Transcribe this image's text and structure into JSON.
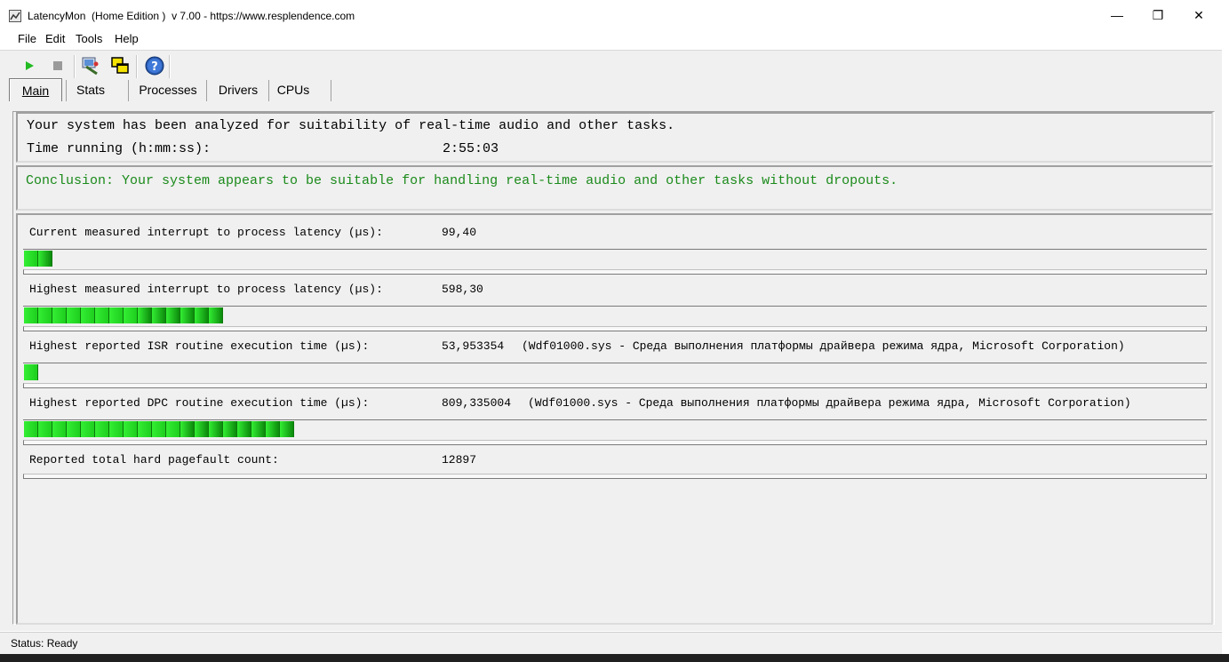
{
  "window": {
    "title": "LatencyMon  (Home Edition )  v 7.00 - https://www.resplendence.com",
    "minimize_glyph": "—",
    "maximize_glyph": "❐",
    "close_glyph": "✕"
  },
  "menu": [
    "File",
    "Edit",
    "Tools",
    "Help"
  ],
  "toolbar": [
    "play-icon",
    "stop-icon",
    "inspect-icon",
    "windows-icon",
    "help-icon"
  ],
  "tabs": [
    "Main",
    "Stats",
    "Processes",
    "Drivers",
    "CPUs"
  ],
  "analysis": {
    "line1": "Your system has been analyzed for suitability of real-time audio and other tasks.",
    "time_label": "Time running (h:mm:ss):",
    "time_value": "2:55:03"
  },
  "conclusion": "Conclusion: Your system appears to be suitable for handling real-time audio and other tasks without dropouts.",
  "metrics": [
    {
      "label": "Current measured interrupt to process latency (µs):",
      "value": "99,40",
      "detail": "",
      "level_segments": 2
    },
    {
      "label": "Highest measured interrupt to process latency (µs):",
      "value": "598,30",
      "detail": "",
      "level_segments": 14
    },
    {
      "label": "Highest reported ISR routine execution time (µs):",
      "value": "53,953354",
      "detail": "(Wdf01000.sys - Среда выполнения платформы драйвера режима ядра, Microsoft Corporation)",
      "level_segments": 1
    },
    {
      "label": "Highest reported DPC routine execution time (µs):",
      "value": "809,335004",
      "detail": "(Wdf01000.sys - Среда выполнения платформы драйвера режима ядра, Microsoft Corporation)",
      "level_segments": 19
    },
    {
      "label": "Reported total hard pagefault count:",
      "value": "12897",
      "detail": "",
      "level_segments": 0
    }
  ],
  "colors": {
    "conclusion_text": "#1a8a1a",
    "bar_light": "#33ee33",
    "bar_dark": "#0c8a0c"
  },
  "status": "Status: Ready"
}
